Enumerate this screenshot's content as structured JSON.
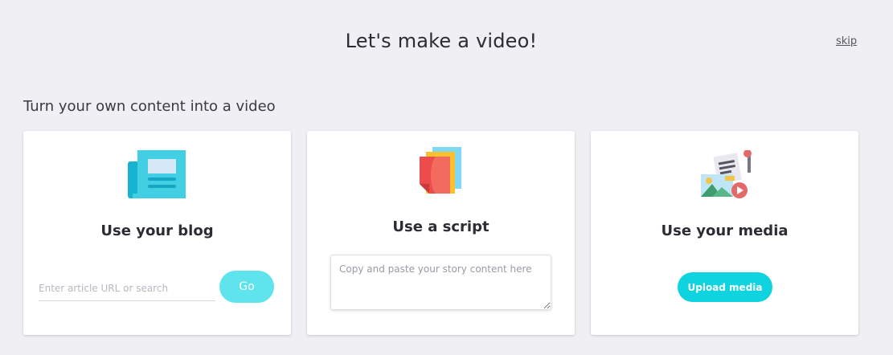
{
  "header": {
    "title": "Let's make a video!",
    "skip_label": "skip"
  },
  "section": {
    "subtitle": "Turn your own content into a video"
  },
  "cards": {
    "blog": {
      "icon": "newspaper-icon",
      "title": "Use your blog",
      "input_placeholder": "Enter article URL or search",
      "input_value": "",
      "button_label": "Go"
    },
    "script": {
      "icon": "script-pages-icon",
      "title": "Use a script",
      "textarea_placeholder": "Copy and paste your story content here",
      "textarea_value": ""
    },
    "media": {
      "icon": "media-collage-icon",
      "title": "Use your media",
      "button_label": "Upload media"
    }
  },
  "colors": {
    "background": "#efeff4",
    "go_button": "#5fe3ec",
    "upload_button": "#0fd4e0"
  }
}
